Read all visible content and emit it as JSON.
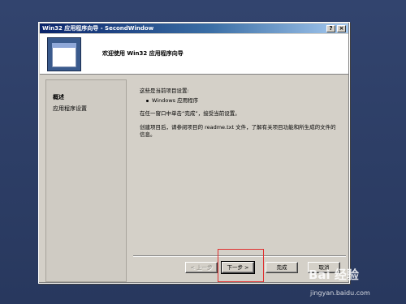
{
  "window": {
    "title": "Win32 应用程序向导 - SecondWindow",
    "help_glyph": "?",
    "close_glyph": "×"
  },
  "header": {
    "title": "欢迎使用 Win32 应用程序向导"
  },
  "nav": {
    "items": [
      {
        "label": "概述",
        "active": true
      },
      {
        "label": "应用程序设置",
        "active": false
      }
    ]
  },
  "content": {
    "intro": "这些是当前项目设置:",
    "bullet": "Windows 应用程序",
    "instruction": "在任一窗口中单击“完成”，接受当前设置。",
    "note": "创建项目后，请参阅项目的 readme.txt 文件，了解有关项目功能和所生成的文件的信息。"
  },
  "buttons": {
    "back": "< 上一步",
    "next": "下一步 >",
    "finish": "完成",
    "cancel": "取消"
  },
  "watermark": {
    "brand": "Bai 经验",
    "site": "jingyan.baidu.com"
  },
  "colors": {
    "titlebar_start": "#0a246a",
    "titlebar_end": "#a6caf0",
    "dialog_face": "#d4d0c8",
    "highlight": "#e03030"
  }
}
